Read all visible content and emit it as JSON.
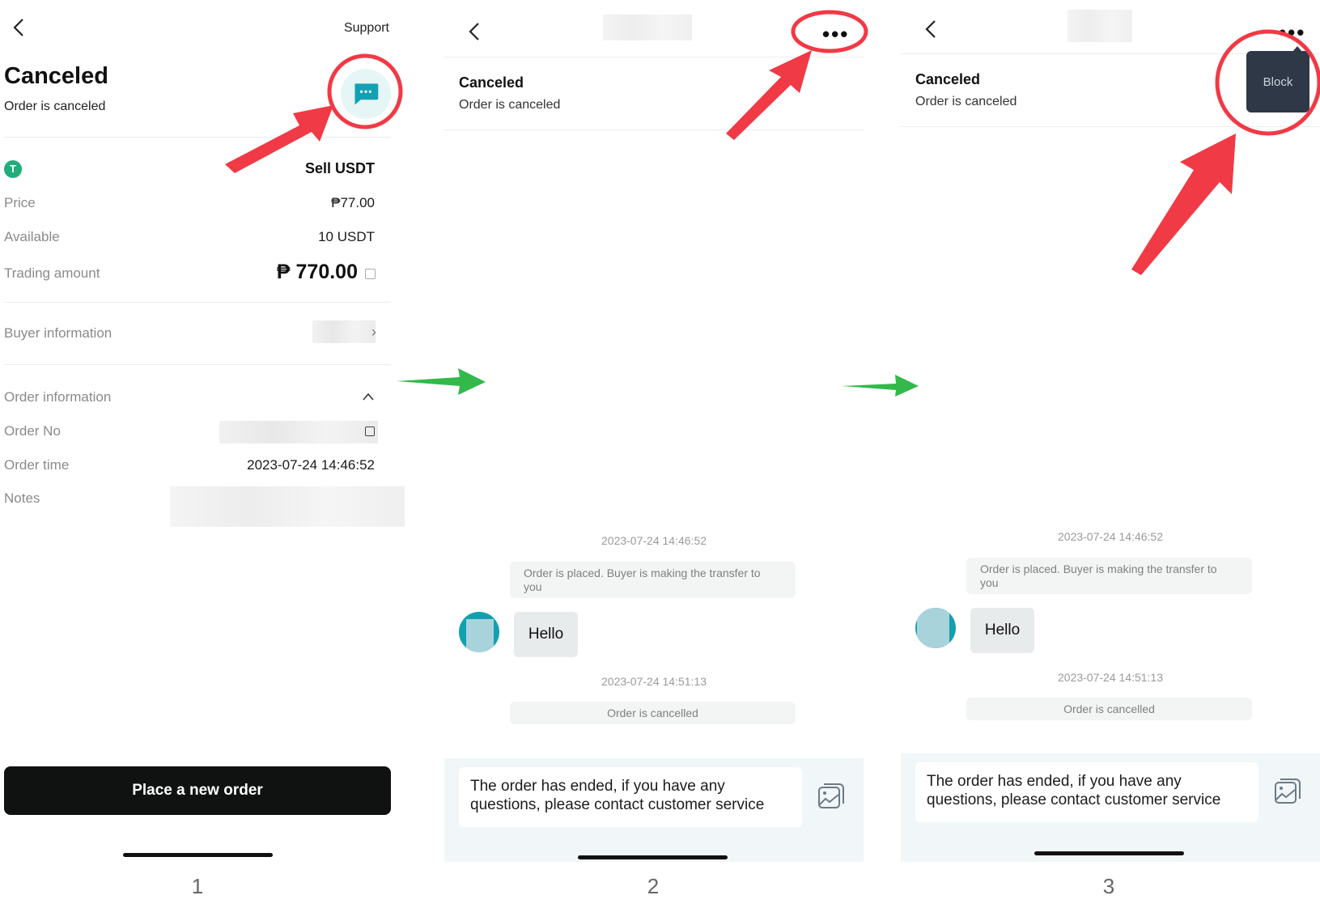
{
  "panel1": {
    "back_icon": "chevron-left-icon",
    "support_label": "Support",
    "status_title": "Canceled",
    "status_subtitle": "Order is canceled",
    "chat_icon": "chat-bubble-icon",
    "coin_icon": "tether-usdt-icon",
    "side_label": "Sell USDT",
    "rows": [
      {
        "label": "Price",
        "value": "₱77.00"
      },
      {
        "label": "Available",
        "value": "10 USDT"
      },
      {
        "label": "Trading amount",
        "value": "₱ 770.00"
      }
    ],
    "buyer_info_label": "Buyer information",
    "order_info_label": "Order information",
    "order_no_label": "Order No",
    "order_time_label": "Order time",
    "order_time_value": "2023-07-24 14:46:52",
    "notes_label": "Notes",
    "cta_label": "Place a new order",
    "step_number": "1"
  },
  "panel2": {
    "status_title": "Canceled",
    "status_subtitle": "Order is canceled",
    "more_icon": "more-horizontal-icon",
    "chat": {
      "ts1": "2023-07-24 14:46:52",
      "sys1": "Order is placed. Buyer is making the transfer to you",
      "bubble": "Hello",
      "ts2": "2023-07-24 14:51:13",
      "sys2": "Order is cancelled"
    },
    "notice": "The order has ended, if you have any questions, please contact customer service",
    "image_icon": "image-gallery-icon",
    "step_number": "2"
  },
  "panel3": {
    "status_title": "Canceled",
    "status_subtitle": "Order is canceled",
    "more_icon": "more-horizontal-icon",
    "menu": {
      "block_label": "Block"
    },
    "chat": {
      "ts1": "2023-07-24 14:46:52",
      "sys1": "Order is placed. Buyer is making the transfer to you",
      "bubble": "Hello",
      "ts2": "2023-07-24 14:51:13",
      "sys2": "Order is cancelled"
    },
    "notice": "The order has ended, if you have any questions, please contact customer service",
    "image_icon": "image-gallery-icon",
    "step_number": "3"
  },
  "annotations": {
    "highlight_color": "#f03a45",
    "flow_arrow_color": "#33b94a"
  }
}
